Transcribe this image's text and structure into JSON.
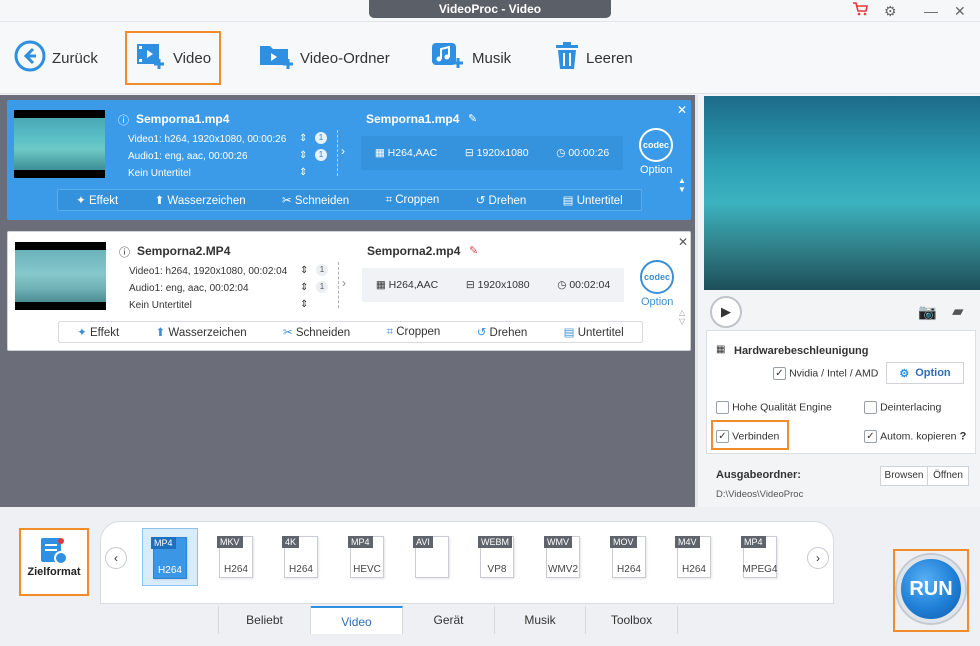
{
  "window": {
    "title": "VideoProc - Video"
  },
  "toolbar": {
    "back_label": "Zurück",
    "video_label": "Video",
    "folder_label": "Video-Ordner",
    "music_label": "Musik",
    "clear_label": "Leeren"
  },
  "tasks": [
    {
      "filename": "Semporna1.mp4",
      "video_info": "Video1: h264, 1920x1080, 00:00:26",
      "audio_info": "Audio1: eng, aac, 00:00:26",
      "subtitle_info": "Kein Untertitel",
      "video_count": "1",
      "audio_count": "1",
      "out_name": "Semporna1.mp4",
      "out_codec": "H264,AAC",
      "out_res": "1920x1080",
      "out_dur": "00:00:26",
      "codec_label": "codec",
      "option_label": "Option"
    },
    {
      "filename": "Semporna2.MP4",
      "video_info": "Video1: h264, 1920x1080, 00:02:04",
      "audio_info": "Audio1: eng, aac, 00:02:04",
      "subtitle_info": "Kein Untertitel",
      "video_count": "1",
      "audio_count": "1",
      "out_name": "Semporna2.mp4",
      "out_codec": "H264,AAC",
      "out_res": "1920x1080",
      "out_dur": "00:02:04",
      "codec_label": "codec",
      "option_label": "Option"
    }
  ],
  "edit_tools": {
    "effect": "Effekt",
    "watermark": "Wasserzeichen",
    "cut": "Schneiden",
    "crop": "Croppen",
    "rotate": "Drehen",
    "subtitle": "Untertitel"
  },
  "settings": {
    "hw_title": "Hardwarebeschleunigung",
    "hw_vendor": "Nvidia / Intel / AMD",
    "option_button": "Option",
    "high_quality": "Hohe Qualität Engine",
    "deinterlacing": "Deinterlacing",
    "merge": "Verbinden",
    "auto_copy": "Autom. kopieren",
    "help": "?",
    "output_label": "Ausgabeordner:",
    "browse": "Browsen",
    "open": "Öffnen",
    "output_path": "D:\\Videos\\VideoProc"
  },
  "bottom": {
    "target_label": "Zielformat",
    "run_label": "RUN",
    "formats": [
      {
        "tag": "MP4",
        "sub": "H264",
        "selected": true
      },
      {
        "tag": "MKV",
        "sub": "H264"
      },
      {
        "tag": "4K",
        "sub": "H264"
      },
      {
        "tag": "MP4",
        "sub": "HEVC"
      },
      {
        "tag": "AVI",
        "sub": ""
      },
      {
        "tag": "WEBM",
        "sub": "VP8"
      },
      {
        "tag": "WMV",
        "sub": "WMV2"
      },
      {
        "tag": "MOV",
        "sub": "H264"
      },
      {
        "tag": "M4V",
        "sub": "H264"
      },
      {
        "tag": "MP4",
        "sub": "MPEG4"
      }
    ],
    "tabs": [
      "Beliebt",
      "Video",
      "Gerät",
      "Musik",
      "Toolbox"
    ],
    "active_tab": "Video"
  },
  "colors": {
    "accent": "#3c9be8",
    "highlight": "#f08c2a",
    "run": "#1f7fd6"
  }
}
